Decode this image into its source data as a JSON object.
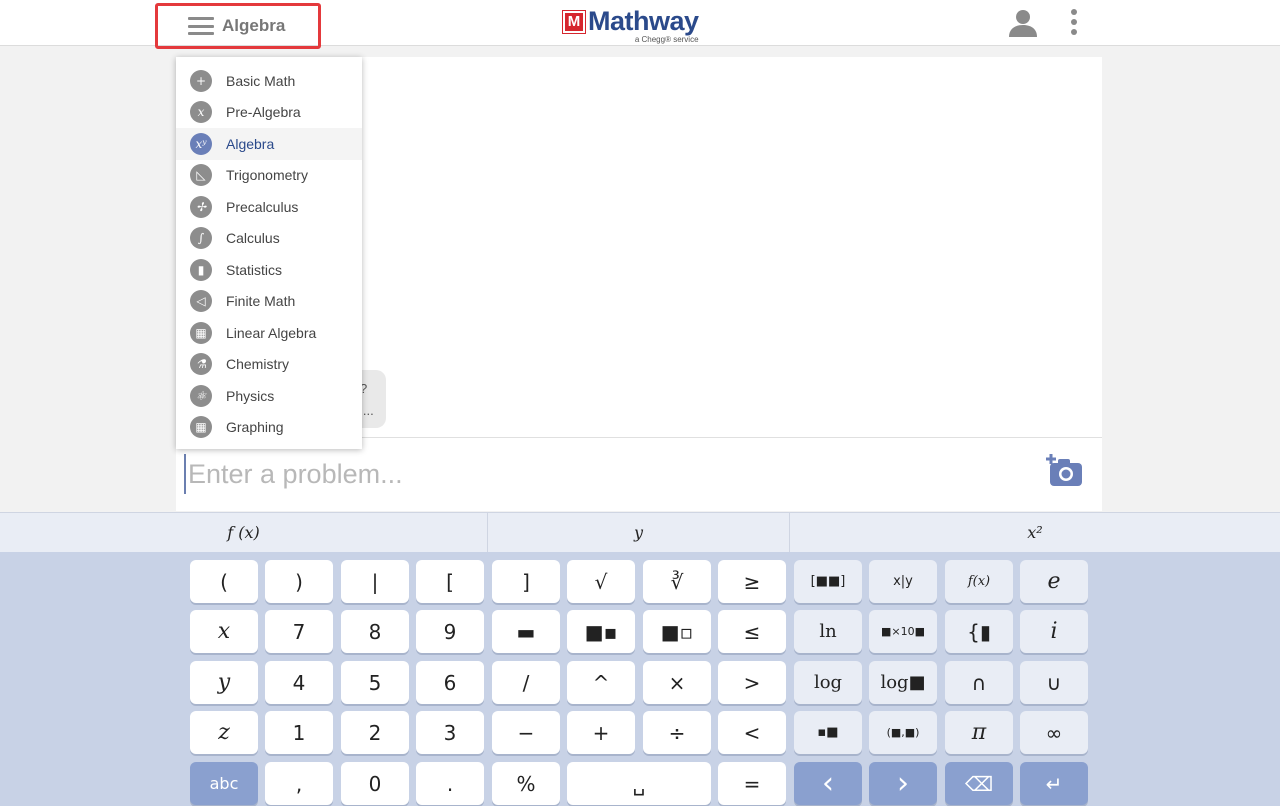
{
  "header": {
    "menu_label": "Algebra",
    "logo_mark": "M",
    "logo_text": "Mathway",
    "logo_sub": "a Chegg® service"
  },
  "dropdown": {
    "items": [
      {
        "label": "Basic Math",
        "icon": "+"
      },
      {
        "label": "Pre-Algebra",
        "icon": "x"
      },
      {
        "label": "Algebra",
        "icon": "xʸ",
        "active": true
      },
      {
        "label": "Trigonometry",
        "icon": "◺"
      },
      {
        "label": "Precalculus",
        "icon": "✢"
      },
      {
        "label": "Calculus",
        "icon": "∫"
      },
      {
        "label": "Statistics",
        "icon": "▮"
      },
      {
        "label": "Finite Math",
        "icon": "◁"
      },
      {
        "label": "Linear Algebra",
        "icon": "▦"
      },
      {
        "label": "Chemistry",
        "icon": "⚗"
      },
      {
        "label": "Physics",
        "icon": "⚛"
      },
      {
        "label": "Graphing",
        "icon": "▦"
      }
    ]
  },
  "chat": {
    "bubble_line1": "?",
    "bubble_line2": "l..."
  },
  "input": {
    "placeholder": "Enter a problem..."
  },
  "keyboard": {
    "tabs": [
      "f (x)",
      "y",
      "x²"
    ],
    "rows": [
      [
        "(",
        ")",
        "|",
        "[",
        "]",
        "√",
        "∛",
        "≥",
        "[■■]",
        "x|y",
        "f(x)",
        "e"
      ],
      [
        "x",
        "7",
        "8",
        "9",
        "▬",
        "■▪",
        "■▫",
        "≤",
        "ln",
        "■×10■",
        "{▮",
        "i"
      ],
      [
        "y",
        "4",
        "5",
        "6",
        "/",
        "^",
        "×",
        ">",
        "log",
        "log■",
        "∩",
        "∪"
      ],
      [
        "z",
        "1",
        "2",
        "3",
        "−",
        "+",
        "÷",
        "<",
        "▪■",
        "(■,■)",
        "π",
        "∞"
      ],
      [
        "abc",
        ",",
        "0",
        ".",
        "%",
        "␣",
        "=",
        "‹",
        "›",
        "⌫",
        "↵"
      ]
    ]
  }
}
